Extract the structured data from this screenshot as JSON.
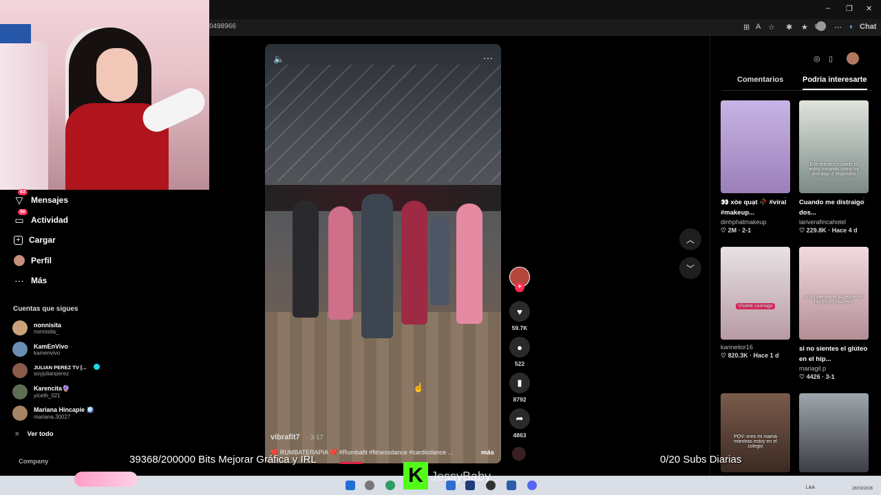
{
  "browser": {
    "url": "0498966",
    "chat_label": "Chat",
    "window_controls": [
      "–",
      "❐",
      "✕"
    ]
  },
  "sidebar": {
    "items": [
      {
        "label": "Mensajes",
        "badge": "63",
        "icon": "send-icon"
      },
      {
        "label": "Actividad",
        "badge": "50",
        "icon": "inbox-icon"
      },
      {
        "label": "Cargar",
        "icon": "upload-icon"
      },
      {
        "label": "Perfil",
        "icon": "profile-avatar"
      },
      {
        "label": "Más",
        "icon": "more-icon"
      }
    ],
    "following_title": "Cuentas que sigues",
    "accounts": [
      {
        "name": "nonnisita",
        "user": "nonnisita_",
        "color": "#c9a27a"
      },
      {
        "name": "KamEnVivo",
        "user": "kamenvivo",
        "color": "#6a8fb3"
      },
      {
        "name": "JULIAN PEREZ TV [...",
        "user": "soyjulianperez",
        "color": "#8a5b4a",
        "verified": true
      },
      {
        "name": "Karencita🔮",
        "user": "yiceth_021",
        "color": "#5c6e54"
      },
      {
        "name": "Mariana Hincapie 🪩",
        "user": "mariana.30027",
        "color": "#a88467"
      }
    ],
    "see_all": "Ver todo",
    "company": "Company"
  },
  "video": {
    "author": "vibrafit7",
    "date": "· 3-17",
    "caption": "❤️ RUMBATERAPIA ❤️ #Rumbafit #fitnessdance #cardiodance ...",
    "more": "más",
    "likes": "59.7K",
    "comments": "522",
    "saves": "8792",
    "shares": "4863"
  },
  "right_panel": {
    "tabs": [
      "Comentarios",
      "Podría interesarte"
    ],
    "active_tab": "Podría interesarte",
    "cards": [
      {
        "title": "👀 xòe quạt 🥀 #viral #makeup...",
        "author": "dinhphatmakeup",
        "stats": "♡ 2M · 2-1",
        "bg": "linear-gradient(180deg,#c8b4e6,#9c7fb8)",
        "thumb_text": ""
      },
      {
        "title": "Cuando me distraigo dos...",
        "author": "lariverafincahotel",
        "stats": "♡ 229.8K · Hace 4 d",
        "bg": "linear-gradient(180deg,#dfe4dc,#7c8a86)",
        "thumb_text": "Ese mesero cuando lo estoy mirando como mi distraigo 2 segundos"
      },
      {
        "title": "",
        "author": "karineitor16",
        "stats": "♡ 820.3K · Hace 1 d",
        "bg": "linear-gradient(180deg,#e8e2e4,#b79aa4)",
        "thumb_text": "Vístete conmigo"
      },
      {
        "title": "si no sientes el glúteo en el hip...",
        "author": "mariagil.p",
        "stats": "♡ 4426 · 3-1",
        "bg": "linear-gradient(180deg,#f1dbe0,#b48d95)",
        "thumb_text": "si no sientes el glúteo en el hip thrust haz esto"
      },
      {
        "title": "",
        "author": "",
        "stats": "",
        "bg": "linear-gradient(180deg,#7a5b4b,#3b2a22)",
        "thumb_text": "POV: eres mi mamá mientras estoy en el colegio"
      },
      {
        "title": "",
        "author": "",
        "stats": "",
        "bg": "linear-gradient(180deg,#9fa6ad,#3c3e44)",
        "thumb_text": ""
      }
    ]
  },
  "overlay": {
    "bits": "39368/200000 Bits Mejorar Gráfica y IRL",
    "subs": "0/20 Subs Diarias",
    "name": "JessyBaby",
    "k": "K"
  },
  "taskbar": {
    "lang": "LAA",
    "time": "28/03/2026"
  },
  "colors": {
    "accent": "#fe2c55",
    "kick_green": "#53fc18"
  }
}
